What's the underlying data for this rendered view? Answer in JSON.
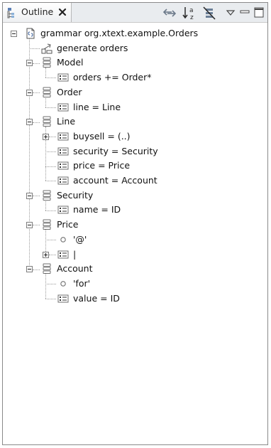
{
  "view": {
    "tab_title": "Outline",
    "toolbar": [
      "link-with-editor-icon",
      "sort-alphabetically-icon",
      "filter-icon",
      "view-menu-icon",
      "minimize-icon",
      "maximize-icon"
    ]
  },
  "tree": [
    {
      "label": "grammar org.xtext.example.Orders",
      "icon": "grammar-file-icon",
      "expander": "minus",
      "depth": 0
    },
    {
      "label": "generate orders",
      "icon": "generate-icon",
      "expander": "",
      "depth": 1
    },
    {
      "label": "Model",
      "icon": "rule-icon",
      "expander": "minus",
      "depth": 1
    },
    {
      "label": "orders += Order*",
      "icon": "assignment-icon",
      "expander": "",
      "depth": 2
    },
    {
      "label": "Order",
      "icon": "rule-icon",
      "expander": "minus",
      "depth": 1
    },
    {
      "label": "line = Line",
      "icon": "assignment-icon",
      "expander": "",
      "depth": 2
    },
    {
      "label": "Line",
      "icon": "rule-icon",
      "expander": "minus",
      "depth": 1
    },
    {
      "label": "buysell = (..)",
      "icon": "assignment-icon",
      "expander": "plus",
      "depth": 2
    },
    {
      "label": "security = Security",
      "icon": "assignment-icon",
      "expander": "",
      "depth": 2
    },
    {
      "label": "price = Price",
      "icon": "assignment-icon",
      "expander": "",
      "depth": 2
    },
    {
      "label": "account = Account",
      "icon": "assignment-icon",
      "expander": "",
      "depth": 2
    },
    {
      "label": "Security",
      "icon": "rule-icon",
      "expander": "minus",
      "depth": 1
    },
    {
      "label": "name = ID",
      "icon": "assignment-icon",
      "expander": "",
      "depth": 2
    },
    {
      "label": "Price",
      "icon": "rule-icon",
      "expander": "minus",
      "depth": 1
    },
    {
      "label": "'@'",
      "icon": "keyword-icon",
      "expander": "",
      "depth": 2
    },
    {
      "label": "|",
      "icon": "assignment-icon",
      "expander": "plus",
      "depth": 2
    },
    {
      "label": "Account",
      "icon": "rule-icon",
      "expander": "minus",
      "depth": 1
    },
    {
      "label": "'for'",
      "icon": "keyword-icon",
      "expander": "",
      "depth": 2
    },
    {
      "label": "value = ID",
      "icon": "assignment-icon",
      "expander": "",
      "depth": 2
    }
  ]
}
